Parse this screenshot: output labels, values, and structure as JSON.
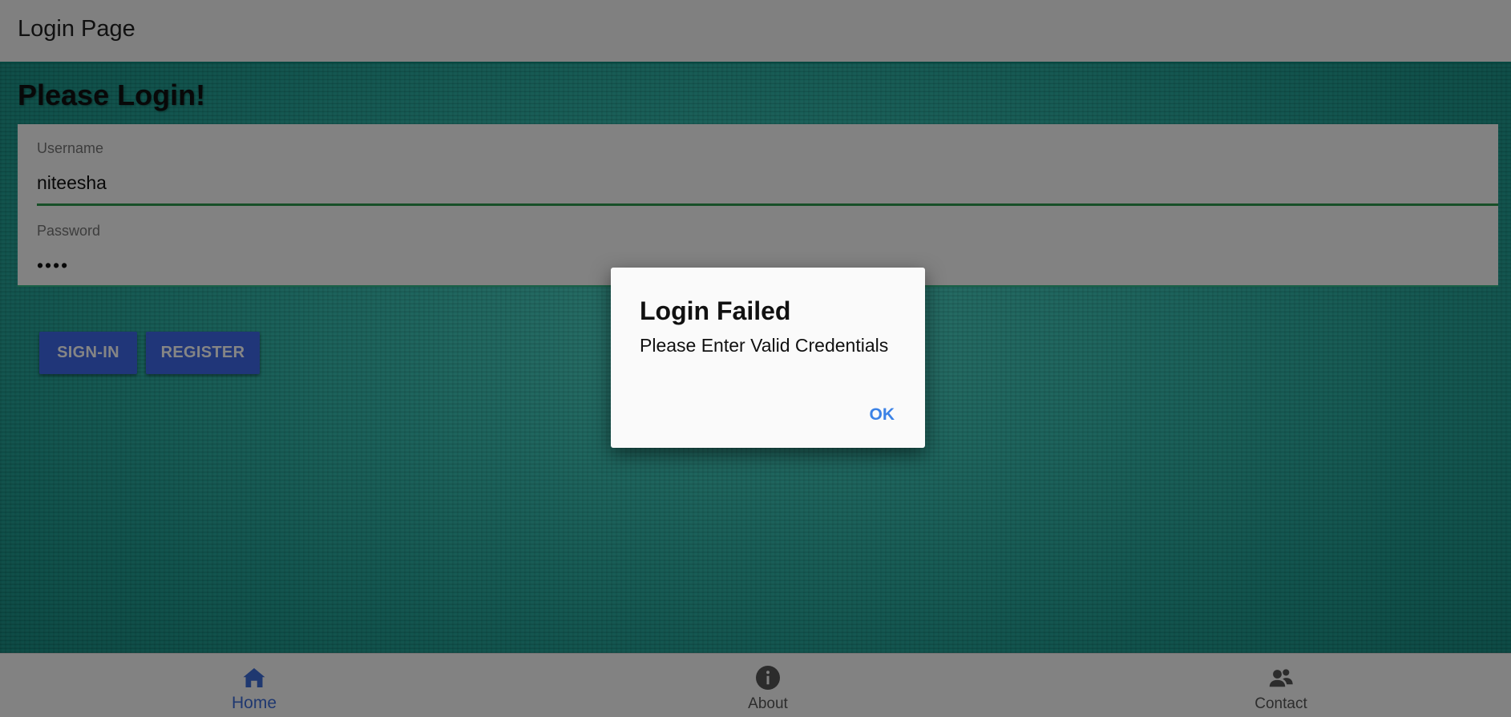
{
  "app_bar": {
    "title": "Login Page"
  },
  "main": {
    "heading": "Please Login!",
    "username": {
      "label": "Username",
      "value": "niteesha"
    },
    "password": {
      "label": "Password",
      "value": "••••"
    },
    "buttons": {
      "sign_in": "SIGN-IN",
      "register": "REGISTER"
    }
  },
  "bottom_nav": {
    "items": [
      {
        "label": "Home",
        "icon": "home-icon",
        "active": true
      },
      {
        "label": "About",
        "icon": "info-icon",
        "active": false
      },
      {
        "label": "Contact",
        "icon": "contacts-icon",
        "active": false
      }
    ]
  },
  "dialog": {
    "title": "Login Failed",
    "message": "Please Enter Valid Credentials",
    "ok_label": "OK"
  },
  "colors": {
    "accent_blue": "#3f68e8",
    "active_nav": "#3c6bd6",
    "dialog_action": "#3b82e6",
    "teal_background": "#33bcae",
    "field_underline": "#2e9a4e"
  }
}
